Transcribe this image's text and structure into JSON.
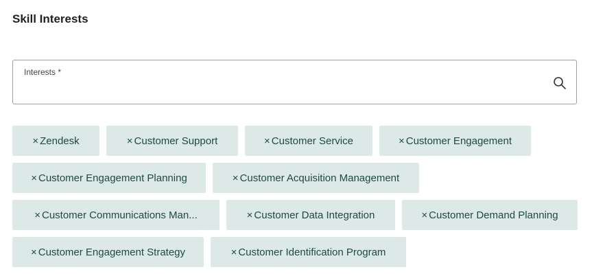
{
  "section": {
    "title": "Skill Interests"
  },
  "interests_field": {
    "label": "Interests *",
    "value": "",
    "search_icon": "search-icon"
  },
  "chips": [
    {
      "label": "Zendesk",
      "remove_glyph": "×"
    },
    {
      "label": "Customer Support",
      "remove_glyph": "×"
    },
    {
      "label": "Customer Service",
      "remove_glyph": "×"
    },
    {
      "label": "Customer Engagement",
      "remove_glyph": "×"
    },
    {
      "label": "Customer Engagement Planning",
      "remove_glyph": "×"
    },
    {
      "label": "Customer Acquisition Management",
      "remove_glyph": "×"
    },
    {
      "label": "Customer Communications Man...",
      "remove_glyph": "×"
    },
    {
      "label": "Customer Data Integration",
      "remove_glyph": "×"
    },
    {
      "label": "Customer Demand Planning",
      "remove_glyph": "×"
    },
    {
      "label": "Customer Engagement Strategy",
      "remove_glyph": "×"
    },
    {
      "label": "Customer Identification Program",
      "remove_glyph": "×"
    }
  ],
  "colors": {
    "chip_background": "#dde9e7",
    "chip_text": "#1d4a44",
    "field_border": "#9aa0a0"
  }
}
